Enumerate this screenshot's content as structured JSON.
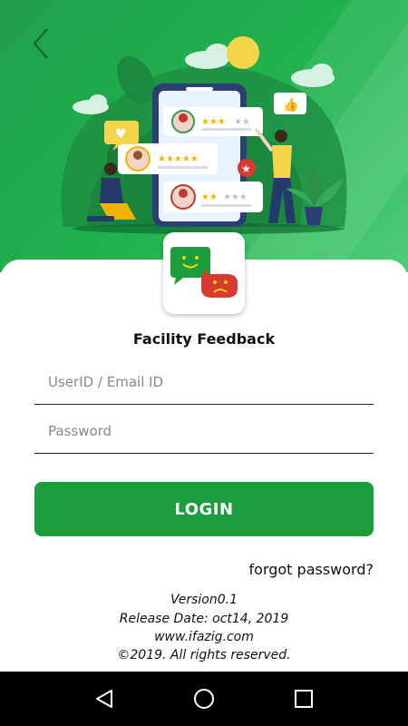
{
  "app": {
    "title": "Facility Feedback"
  },
  "form": {
    "userid_placeholder": "UserID / Email ID",
    "password_placeholder": "Password",
    "login_label": "LOGIN",
    "forgot_label": "forgot password?"
  },
  "footer": {
    "version": "Version0.1",
    "release_date": "Release Date: oct14, 2019",
    "website": "www.ifazig.com",
    "copyright": "©2019. All rights reserved."
  },
  "navigation": {
    "back_icon": "chevron-left-icon",
    "nav_back_icon": "triangle-back-icon",
    "nav_home_icon": "circle-home-icon",
    "nav_recents_icon": "square-recents-icon"
  },
  "colors": {
    "primary_green": "#1a9e3c",
    "hero_green": "#22b24f",
    "sad_red": "#d83a32",
    "star_yellow": "#f5b301"
  }
}
